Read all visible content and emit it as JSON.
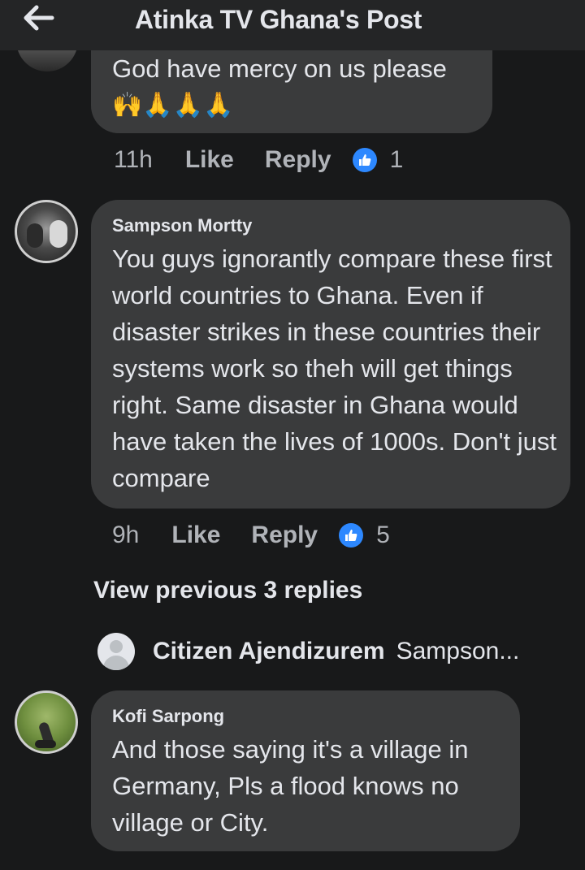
{
  "header": {
    "title": "Atinka TV Ghana's Post",
    "back_icon": "arrow-left-icon"
  },
  "comments": [
    {
      "text": "God have mercy on us please",
      "emojis": "🙌🙏🙏🙏",
      "time": "11h",
      "like_label": "Like",
      "reply_label": "Reply",
      "reaction_count": "1"
    },
    {
      "author": "Sampson Mortty",
      "text": "You guys ignorantly compare these first world countries to Ghana. Even if disaster strikes in these countries their systems work so theh will get things right. Same disaster in Ghana would have taken the lives of 1000s. Don't just compare",
      "time": "9h",
      "like_label": "Like",
      "reply_label": "Reply",
      "reaction_count": "5"
    },
    {
      "author": "Kofi Sarpong",
      "text": "And those saying it's a village in Germany, Pls a flood knows no village or City."
    }
  ],
  "replies": {
    "view_previous_label": "View previous 3 replies",
    "preview_name": "Citizen Ajendizurem",
    "preview_snippet": "Sampson..."
  },
  "colors": {
    "background": "#18191a",
    "bubble": "#3a3b3c",
    "like_blue": "#2d88ff",
    "secondary_text": "#b0b3b8"
  }
}
